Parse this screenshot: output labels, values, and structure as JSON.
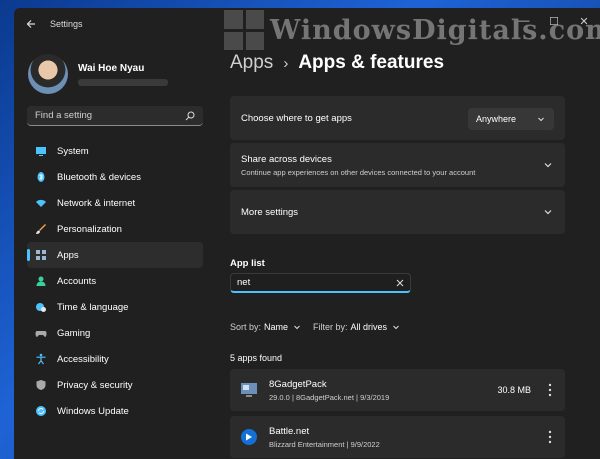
{
  "window": {
    "title": "Settings",
    "controls": {
      "minimize": "—",
      "maximize": "☐",
      "close": "✕"
    }
  },
  "watermark": {
    "text": "WindowsDigitals.com"
  },
  "profile": {
    "name": "Wai Hoe Nyau"
  },
  "search": {
    "placeholder": "Find a setting",
    "icon": "search-icon"
  },
  "sidebar": {
    "items": [
      {
        "label": "System",
        "icon": "system-icon",
        "color": "#4cc2ff"
      },
      {
        "label": "Bluetooth & devices",
        "icon": "bluetooth-icon",
        "color": "#4cc2ff"
      },
      {
        "label": "Network & internet",
        "icon": "wifi-icon",
        "color": "#4cc2ff"
      },
      {
        "label": "Personalization",
        "icon": "brush-icon",
        "color": "#f0a34b"
      },
      {
        "label": "Apps",
        "icon": "apps-icon",
        "color": "#9ab7d3",
        "active": true
      },
      {
        "label": "Accounts",
        "icon": "accounts-icon",
        "color": "#3ccf9e"
      },
      {
        "label": "Time & language",
        "icon": "globe-clock-icon",
        "color": "#4cc2ff"
      },
      {
        "label": "Gaming",
        "icon": "gamepad-icon",
        "color": "#a9a9a9"
      },
      {
        "label": "Accessibility",
        "icon": "accessibility-icon",
        "color": "#4cc2ff"
      },
      {
        "label": "Privacy & security",
        "icon": "shield-icon",
        "color": "#a9a9a9"
      },
      {
        "label": "Windows Update",
        "icon": "update-icon",
        "color": "#4cc2ff"
      }
    ]
  },
  "breadcrumb": {
    "parent": "Apps",
    "separator": "›",
    "current": "Apps & features"
  },
  "cards": {
    "where": {
      "title": "Choose where to get apps",
      "dropdown": "Anywhere"
    },
    "share": {
      "title": "Share across devices",
      "subtitle": "Continue app experiences on other devices connected to your account"
    },
    "more": {
      "title": "More settings"
    }
  },
  "app_list": {
    "title": "App list",
    "value": "net",
    "sort_label": "Sort by:",
    "sort_value": "Name",
    "filter_label": "Filter by:",
    "filter_value": "All drives",
    "found": "5 apps found",
    "apps": [
      {
        "name": "8GadgetPack",
        "version": "29.0.0",
        "publisher": "8GadgetPack.net",
        "date": "9/3/2019",
        "size": "30.8 MB"
      },
      {
        "name": "Battle.net",
        "publisher": "Blizzard Entertainment",
        "date": "9/9/2022",
        "size": ""
      }
    ]
  },
  "accent": "#4cc2ff"
}
